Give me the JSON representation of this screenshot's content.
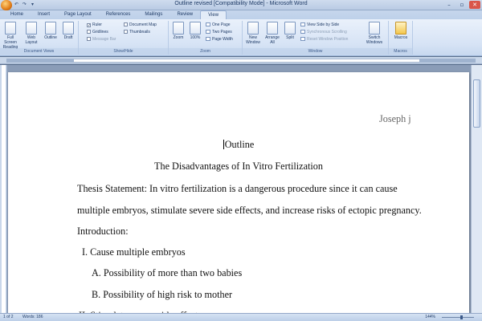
{
  "window": {
    "title": "Outline revised [Compatibility Mode] - Microsoft Word",
    "minimize": "–",
    "maximize": "▫",
    "close": "✕",
    "qat": [
      "↶",
      "↷",
      "▾"
    ]
  },
  "tabs": [
    "Home",
    "Insert",
    "Page Layout",
    "References",
    "Mailings",
    "Review",
    "View"
  ],
  "active_tab": "View",
  "ribbon": {
    "document_views": {
      "label": "Document Views",
      "buttons": [
        "Full Screen Reading",
        "Web Layout",
        "Outline",
        "Draft"
      ]
    },
    "show_hide": {
      "label": "Show/Hide",
      "items": [
        "Ruler",
        "Gridlines",
        "Message Bar",
        "Document Map",
        "Thumbnails"
      ],
      "ruler_check": "✓"
    },
    "zoom": {
      "label": "Zoom",
      "buttons": [
        "Zoom",
        "100%"
      ],
      "items": [
        "One Page",
        "Two Pages",
        "Page Width"
      ]
    },
    "window": {
      "label": "Window",
      "buttons": [
        "New Window",
        "Arrange All",
        "Split"
      ],
      "items": [
        "View Side by Side",
        "Synchronous Scrolling",
        "Reset Window Position"
      ],
      "switch": "Switch Windows"
    },
    "macros": {
      "label": "Macros",
      "button": "Macros"
    }
  },
  "document": {
    "author": "Joseph j",
    "heading": "Outline",
    "title": "The Disadvantages of In Vitro Fertilization",
    "thesis_line1": "Thesis Statement: In vitro fertilization is a dangerous procedure since it can cause",
    "thesis_line2": "multiple embryos, stimulate severe side effects, and increase risks of ectopic pregnancy.",
    "intro": "Introduction:",
    "item1": "I.  Cause multiple embryos",
    "item1a": "A. Possibility of more than two babies",
    "item1b": "B. Possibility of high risk to mother",
    "item2": "II.  Stimulate severe side effects"
  },
  "status": {
    "page": "1 of 2",
    "words": "Words: 186",
    "zoom": "144%"
  }
}
